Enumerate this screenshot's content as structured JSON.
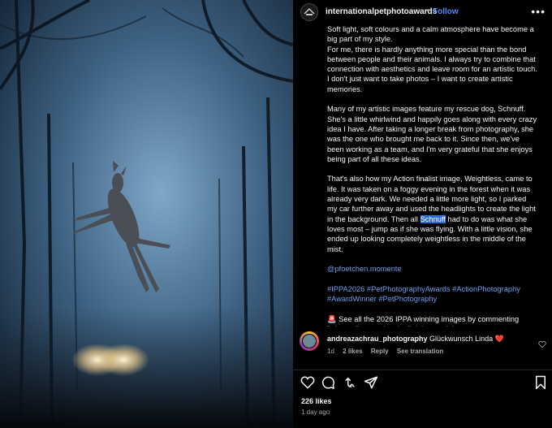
{
  "post": {
    "username": "internationalpetphotoawards",
    "dot": "•",
    "follow_label": "Follow",
    "more_label": "•••"
  },
  "caption": {
    "p1_line": "Soft light, soft colours and a calm atmosphere have become a big part of my style.",
    "p1_rest": "For me, there is hardly anything more special than the bond between people and their animals. I always try to combine that connection with aesthetics and leave room for an artistic touch. I don't just want to take photos – I want to create artistic memories.",
    "p2": "Many of my artistic images feature my rescue dog, Schnuff. She's a little whirlwind and happily goes along with every crazy idea I have. After taking a longer break from photography, she was the one who brought me back to it. Since then, we've been working as a team, and I'm very grateful that she enjoys being part of all these ideas.",
    "p3_before": "That's also how my Action finalist image, Weightless, came to life. It was taken on a foggy evening in the forest when it was already very dark. We needed a little more light, so I parked my car further away and used the headlights to create the light in the background. Then all ",
    "p3_highlight": "Schnuff",
    "p3_after": " had to do was what she loves most – jump as if she was flying. With a little vision, she ended up looking completely weightless in the middle of the mist.",
    "mention": "@pfoetchen.momente",
    "hashtags": "#IPPA2026 #PetPhotographyAwards #ActionPhotography #AwardWinner #PetPhotography",
    "cta_emoji": "🚨",
    "cta": "See all the 2026 IPPA winning images by commenting \"winners\" to receive the link in your inbox.",
    "time": "1d"
  },
  "comment": {
    "user": "andreazachrau_photography",
    "text": "Glückwunsch Linda",
    "emoji": "❤️",
    "time": "1d",
    "likes": "2 likes",
    "reply": "Reply",
    "translation": "See translation"
  },
  "footer": {
    "likes": "226 likes",
    "ago": "1 day ago"
  },
  "icons": [
    "heart-icon",
    "comment-icon",
    "share-icon",
    "send-icon",
    "bookmark-icon",
    "more-icon"
  ],
  "colors": {
    "accent": "#4a8cf7",
    "background": "#000000",
    "highlight": "#2f6bd6",
    "link": "#6f9ef0"
  }
}
